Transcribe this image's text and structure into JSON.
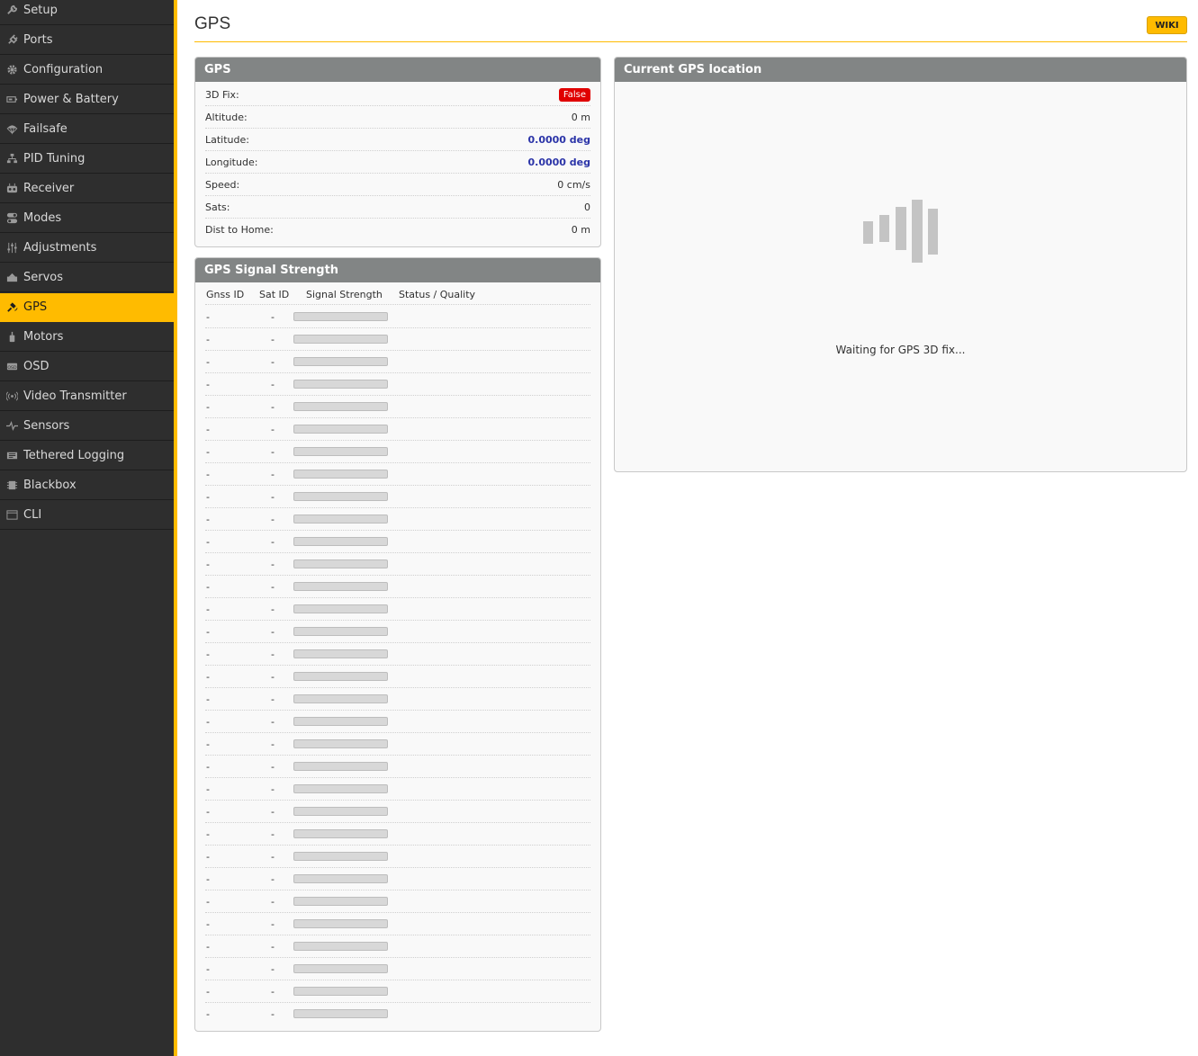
{
  "sidebar": {
    "items": [
      {
        "label": "Setup",
        "icon": "wrench-icon",
        "active": false
      },
      {
        "label": "Ports",
        "icon": "plug-icon",
        "active": false
      },
      {
        "label": "Configuration",
        "icon": "gear-icon",
        "active": false
      },
      {
        "label": "Power & Battery",
        "icon": "battery-icon",
        "active": false
      },
      {
        "label": "Failsafe",
        "icon": "parachute-icon",
        "active": false
      },
      {
        "label": "PID Tuning",
        "icon": "sitemap-icon",
        "active": false
      },
      {
        "label": "Receiver",
        "icon": "remote-control-icon",
        "active": false
      },
      {
        "label": "Modes",
        "icon": "toggle-icon",
        "active": false
      },
      {
        "label": "Adjustments",
        "icon": "sliders-icon",
        "active": false
      },
      {
        "label": "Servos",
        "icon": "servo-icon",
        "active": false
      },
      {
        "label": "GPS",
        "icon": "satellite-icon",
        "active": true
      },
      {
        "label": "Motors",
        "icon": "motor-icon",
        "active": false
      },
      {
        "label": "OSD",
        "icon": "osd-icon",
        "active": false
      },
      {
        "label": "Video Transmitter",
        "icon": "broadcast-icon",
        "active": false
      },
      {
        "label": "Sensors",
        "icon": "pulse-icon",
        "active": false
      },
      {
        "label": "Tethered Logging",
        "icon": "logging-icon",
        "active": false
      },
      {
        "label": "Blackbox",
        "icon": "chip-icon",
        "active": false
      },
      {
        "label": "CLI",
        "icon": "terminal-icon",
        "active": false
      }
    ]
  },
  "header": {
    "title": "GPS",
    "wiki_label": "WIKI"
  },
  "gps_panel": {
    "title": "GPS",
    "rows": [
      {
        "label": "3D Fix:",
        "value": "False",
        "style": "badge"
      },
      {
        "label": "Altitude:",
        "value": "0 m",
        "style": "plain"
      },
      {
        "label": "Latitude:",
        "value": "0.0000 deg",
        "style": "blue"
      },
      {
        "label": "Longitude:",
        "value": "0.0000 deg",
        "style": "blue"
      },
      {
        "label": "Speed:",
        "value": "0 cm/s",
        "style": "plain"
      },
      {
        "label": "Sats:",
        "value": "0",
        "style": "plain"
      },
      {
        "label": "Dist to Home:",
        "value": "0 m",
        "style": "plain"
      }
    ]
  },
  "signal_panel": {
    "title": "GPS Signal Strength",
    "columns": [
      "Gnss ID",
      "Sat ID",
      "Signal Strength",
      "Status / Quality"
    ],
    "rows": [
      {
        "gnss": "-",
        "sat": "-",
        "strength": 0,
        "status": ""
      },
      {
        "gnss": "-",
        "sat": "-",
        "strength": 0,
        "status": ""
      },
      {
        "gnss": "-",
        "sat": "-",
        "strength": 0,
        "status": ""
      },
      {
        "gnss": "-",
        "sat": "-",
        "strength": 0,
        "status": ""
      },
      {
        "gnss": "-",
        "sat": "-",
        "strength": 0,
        "status": ""
      },
      {
        "gnss": "-",
        "sat": "-",
        "strength": 0,
        "status": ""
      },
      {
        "gnss": "-",
        "sat": "-",
        "strength": 0,
        "status": ""
      },
      {
        "gnss": "-",
        "sat": "-",
        "strength": 0,
        "status": ""
      },
      {
        "gnss": "-",
        "sat": "-",
        "strength": 0,
        "status": ""
      },
      {
        "gnss": "-",
        "sat": "-",
        "strength": 0,
        "status": ""
      },
      {
        "gnss": "-",
        "sat": "-",
        "strength": 0,
        "status": ""
      },
      {
        "gnss": "-",
        "sat": "-",
        "strength": 0,
        "status": ""
      },
      {
        "gnss": "-",
        "sat": "-",
        "strength": 0,
        "status": ""
      },
      {
        "gnss": "-",
        "sat": "-",
        "strength": 0,
        "status": ""
      },
      {
        "gnss": "-",
        "sat": "-",
        "strength": 0,
        "status": ""
      },
      {
        "gnss": "-",
        "sat": "-",
        "strength": 0,
        "status": ""
      },
      {
        "gnss": "-",
        "sat": "-",
        "strength": 0,
        "status": ""
      },
      {
        "gnss": "-",
        "sat": "-",
        "strength": 0,
        "status": ""
      },
      {
        "gnss": "-",
        "sat": "-",
        "strength": 0,
        "status": ""
      },
      {
        "gnss": "-",
        "sat": "-",
        "strength": 0,
        "status": ""
      },
      {
        "gnss": "-",
        "sat": "-",
        "strength": 0,
        "status": ""
      },
      {
        "gnss": "-",
        "sat": "-",
        "strength": 0,
        "status": ""
      },
      {
        "gnss": "-",
        "sat": "-",
        "strength": 0,
        "status": ""
      },
      {
        "gnss": "-",
        "sat": "-",
        "strength": 0,
        "status": ""
      },
      {
        "gnss": "-",
        "sat": "-",
        "strength": 0,
        "status": ""
      },
      {
        "gnss": "-",
        "sat": "-",
        "strength": 0,
        "status": ""
      },
      {
        "gnss": "-",
        "sat": "-",
        "strength": 0,
        "status": ""
      },
      {
        "gnss": "-",
        "sat": "-",
        "strength": 0,
        "status": ""
      },
      {
        "gnss": "-",
        "sat": "-",
        "strength": 0,
        "status": ""
      },
      {
        "gnss": "-",
        "sat": "-",
        "strength": 0,
        "status": ""
      },
      {
        "gnss": "-",
        "sat": "-",
        "strength": 0,
        "status": ""
      },
      {
        "gnss": "-",
        "sat": "-",
        "strength": 0,
        "status": ""
      }
    ]
  },
  "location_panel": {
    "title": "Current GPS location",
    "waiting_text": "Waiting for GPS 3D fix...",
    "icon": "signal-bars-icon"
  },
  "colors": {
    "accent": "#ffbb00",
    "sidebar_bg": "#2e2e2e",
    "panel_header": "#828585",
    "false_badge": "#e00000",
    "coordinate_value": "#2b34a8"
  }
}
